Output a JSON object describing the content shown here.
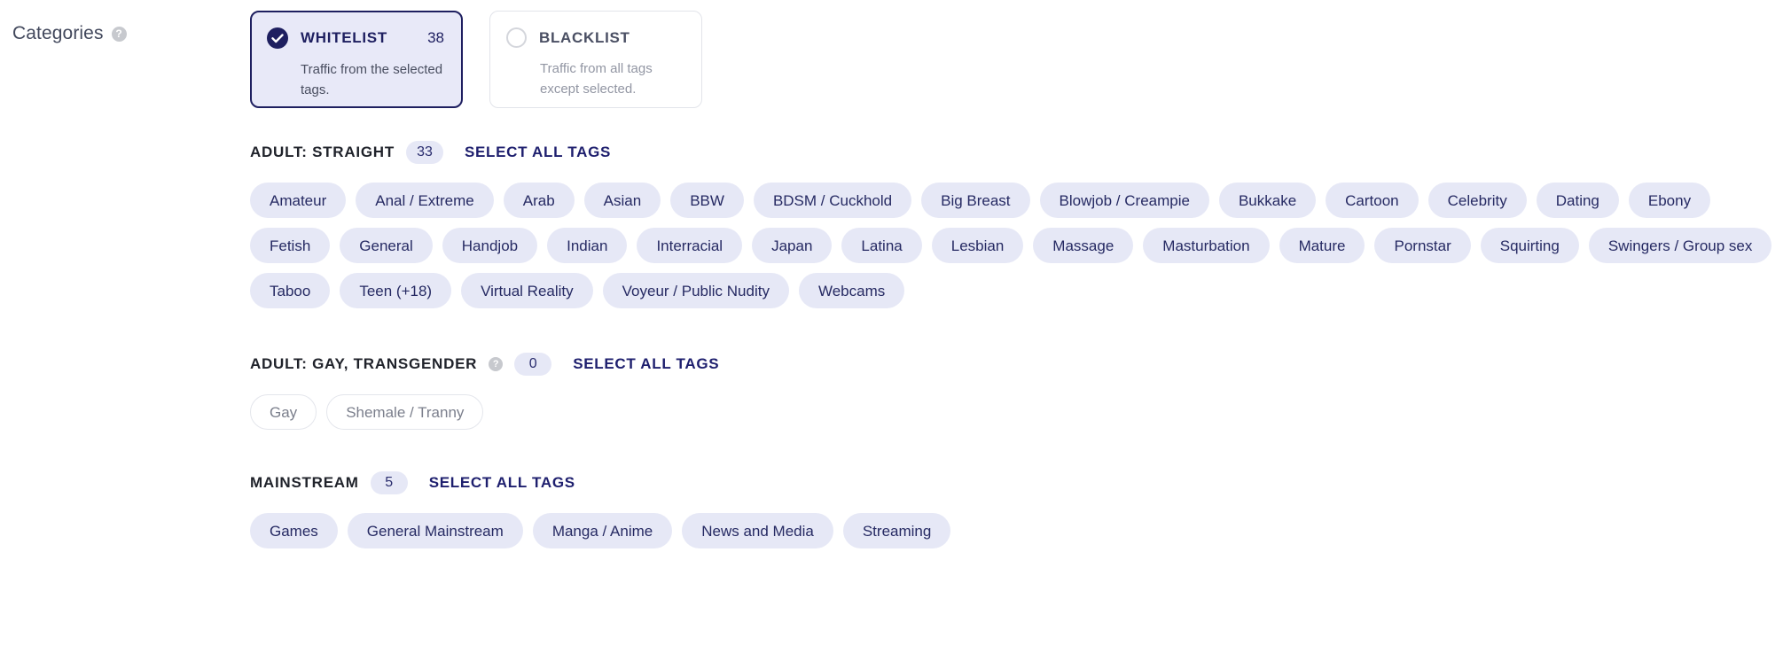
{
  "field": {
    "label": "Categories",
    "help_icon": "question-mark-icon",
    "help_glyph": "?"
  },
  "modes": [
    {
      "id": "whitelist",
      "label": "WHITELIST",
      "count": "38",
      "description": "Traffic from the selected tags.",
      "selected": true,
      "icon": "check-circle-filled-icon"
    },
    {
      "id": "blacklist",
      "label": "BLACKLIST",
      "count": "",
      "description": "Traffic from all tags except selected.",
      "selected": false,
      "icon": "radio-circle-empty-icon"
    }
  ],
  "select_all_label": "SELECT ALL TAGS",
  "sections": [
    {
      "id": "adult-straight",
      "title": "ADULT: STRAIGHT",
      "count": "33",
      "has_help": false,
      "tags": [
        {
          "label": "Amateur",
          "selected": true
        },
        {
          "label": "Anal / Extreme",
          "selected": true
        },
        {
          "label": "Arab",
          "selected": true
        },
        {
          "label": "Asian",
          "selected": true
        },
        {
          "label": "BBW",
          "selected": true
        },
        {
          "label": "BDSM / Cuckhold",
          "selected": true
        },
        {
          "label": "Big Breast",
          "selected": true
        },
        {
          "label": "Blowjob / Creampie",
          "selected": true
        },
        {
          "label": "Bukkake",
          "selected": true
        },
        {
          "label": "Cartoon",
          "selected": true
        },
        {
          "label": "Celebrity",
          "selected": true
        },
        {
          "label": "Dating",
          "selected": true
        },
        {
          "label": "Ebony",
          "selected": true
        },
        {
          "label": "Fetish",
          "selected": true
        },
        {
          "label": "General",
          "selected": true
        },
        {
          "label": "Handjob",
          "selected": true
        },
        {
          "label": "Indian",
          "selected": true
        },
        {
          "label": "Interracial",
          "selected": true
        },
        {
          "label": "Japan",
          "selected": true
        },
        {
          "label": "Latina",
          "selected": true
        },
        {
          "label": "Lesbian",
          "selected": true
        },
        {
          "label": "Massage",
          "selected": true
        },
        {
          "label": "Masturbation",
          "selected": true
        },
        {
          "label": "Mature",
          "selected": true
        },
        {
          "label": "Pornstar",
          "selected": true
        },
        {
          "label": "Squirting",
          "selected": true
        },
        {
          "label": "Swingers / Group sex",
          "selected": true
        },
        {
          "label": "Taboo",
          "selected": true
        },
        {
          "label": "Teen (+18)",
          "selected": true
        },
        {
          "label": "Virtual Reality",
          "selected": true
        },
        {
          "label": "Voyeur / Public Nudity",
          "selected": true
        },
        {
          "label": "Webcams",
          "selected": true
        }
      ]
    },
    {
      "id": "adult-gay-transgender",
      "title": "ADULT: GAY, TRANSGENDER",
      "count": "0",
      "has_help": true,
      "help_glyph": "?",
      "tags": [
        {
          "label": "Gay",
          "selected": false
        },
        {
          "label": "Shemale / Tranny",
          "selected": false
        }
      ]
    },
    {
      "id": "mainstream",
      "title": "MAINSTREAM",
      "count": "5",
      "has_help": false,
      "tags": [
        {
          "label": "Games",
          "selected": true
        },
        {
          "label": "General Mainstream",
          "selected": true
        },
        {
          "label": "Manga / Anime",
          "selected": true
        },
        {
          "label": "News and Media",
          "selected": true
        },
        {
          "label": "Streaming",
          "selected": true
        }
      ]
    }
  ],
  "colors": {
    "accent": "#1e1f60",
    "tag_selected_bg": "#e6e8f6",
    "tag_selected_text": "#262a63",
    "tag_off_border": "#e4e6ec",
    "tag_off_text": "#7b7f8c",
    "card_selected_bg": "#e8e9f8"
  }
}
